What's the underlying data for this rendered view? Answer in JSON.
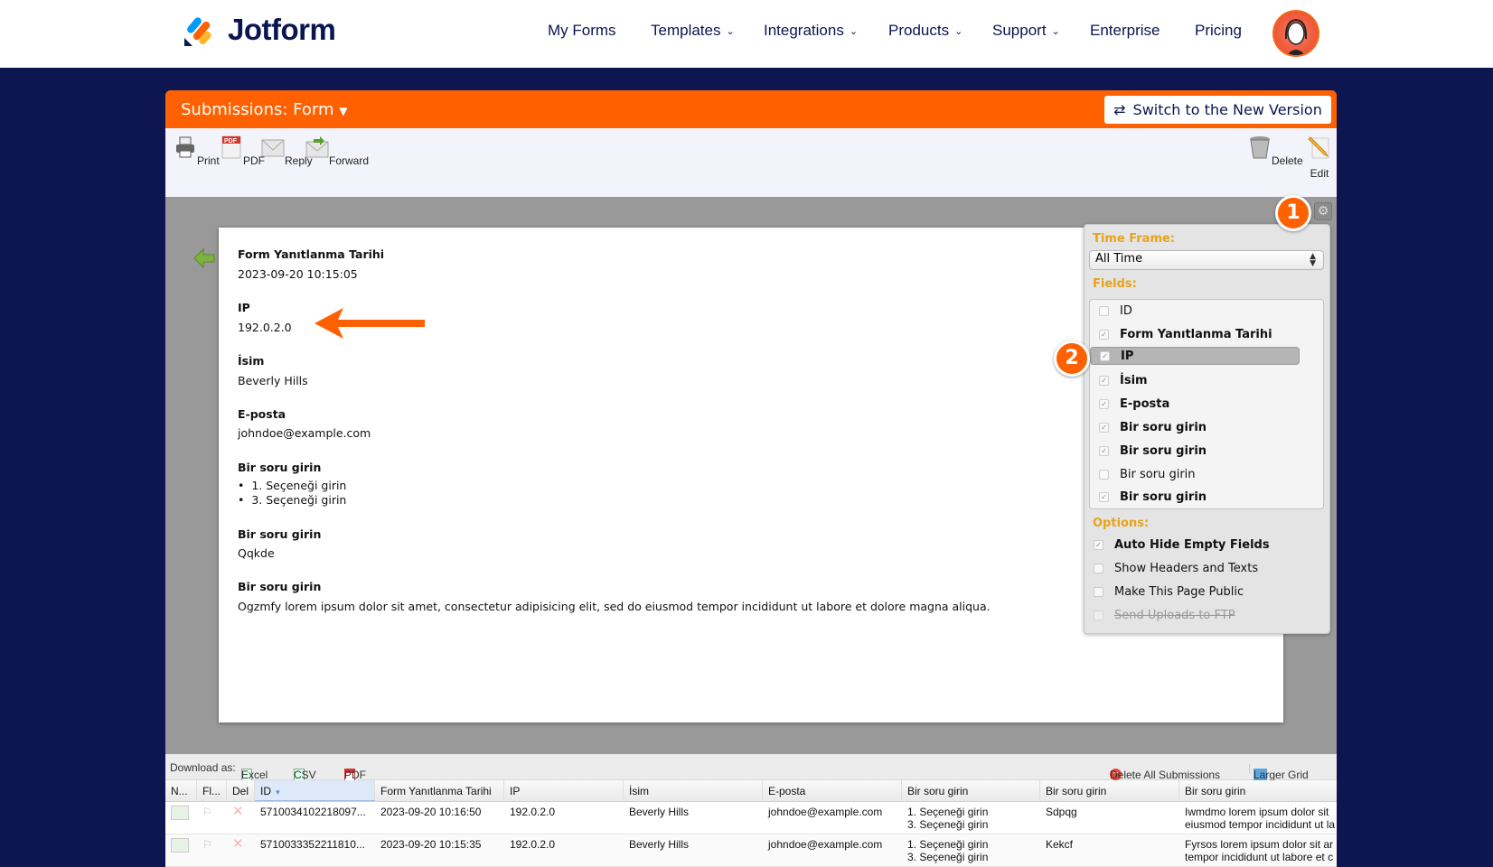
{
  "nav": {
    "brand": "Jotform",
    "items": [
      {
        "label": "My Forms",
        "dropdown": false
      },
      {
        "label": "Templates",
        "dropdown": true
      },
      {
        "label": "Integrations",
        "dropdown": true
      },
      {
        "label": "Products",
        "dropdown": true
      },
      {
        "label": "Support",
        "dropdown": true
      },
      {
        "label": "Enterprise",
        "dropdown": false
      },
      {
        "label": "Pricing",
        "dropdown": false
      }
    ]
  },
  "header": {
    "title": "Submissions: Form",
    "switch_label": "Switch to the New Version"
  },
  "toolbar": {
    "print": "Print",
    "pdf": "PDF",
    "reply": "Reply",
    "forward": "Forward",
    "delete": "Delete",
    "edit": "Edit"
  },
  "submission": [
    {
      "label": "Form Yanıtlanma Tarihi",
      "value": "2023-09-20 10:15:05"
    },
    {
      "label": "IP",
      "value": "192.0.2.0"
    },
    {
      "label": "İsim",
      "value": "Beverly Hills"
    },
    {
      "label": "E-posta",
      "value": "johndoe@example.com"
    },
    {
      "label": "Bir soru girin",
      "list": [
        "1. Seçeneği girin",
        "3. Seçeneği girin"
      ]
    },
    {
      "label": "Bir soru girin",
      "value": "Qqkde"
    },
    {
      "label": "Bir soru girin",
      "value": "Ogzmfy lorem ipsum dolor sit amet, consectetur adipisicing elit, sed do eiusmod tempor incididunt ut labore et dolore magna aliqua."
    }
  ],
  "settings": {
    "time_frame_label": "Time Frame:",
    "time_frame_value": "All Time",
    "fields_label": "Fields:",
    "fields": [
      {
        "label": "ID",
        "checked": false
      },
      {
        "label": "Form Yanıtlanma Tarihi",
        "checked": true
      },
      {
        "label": "IP",
        "checked": true
      },
      {
        "label": "İsim",
        "checked": true
      },
      {
        "label": "E-posta",
        "checked": true
      },
      {
        "label": "Bir soru girin",
        "checked": true
      },
      {
        "label": "Bir soru girin",
        "checked": true
      },
      {
        "label": "Bir soru girin",
        "checked": false
      },
      {
        "label": "Bir soru girin",
        "checked": true
      }
    ],
    "options_label": "Options:",
    "options": [
      {
        "label": "Auto Hide Empty Fields",
        "checked": true
      },
      {
        "label": "Show Headers and Texts",
        "checked": false
      },
      {
        "label": "Make This Page Public",
        "checked": false
      },
      {
        "label": "Send Uploads to FTP",
        "checked": false,
        "disabled": true
      }
    ]
  },
  "badges": {
    "one": "1",
    "two": "2"
  },
  "download": {
    "label": "Download as:",
    "excel": "Excel",
    "csv": "CSV",
    "pdf": "PDF",
    "delete_all": "Delete All Submissions",
    "larger_grid": "Larger Grid"
  },
  "grid": {
    "columns": [
      "N...",
      "Fl...",
      "Del",
      "ID",
      "Form Yanıtlanma Tarihi",
      "IP",
      "İsim",
      "E-posta",
      "Bir soru girin",
      "Bir soru girin",
      "Bir soru girin"
    ],
    "rows": [
      {
        "id": "5710034102218097...",
        "date": "2023-09-20 10:16:50",
        "ip": "192.0.2.0",
        "name": "Beverly Hills",
        "email": "johndoe@example.com",
        "q1a": "1. Seçeneği girin",
        "q1b": "3. Seçeneği girin",
        "q2": "Sdpqg",
        "q3a": "Iwmdmo lorem ipsum dolor sit",
        "q3b": "eiusmod tempor incididunt ut la"
      },
      {
        "id": "5710033352211810...",
        "date": "2023-09-20 10:15:35",
        "ip": "192.0.2.0",
        "name": "Beverly Hills",
        "email": "johndoe@example.com",
        "q1a": "1. Seçeneği girin",
        "q1b": "3. Seçeneği girin",
        "q2": "Kekcf",
        "q3a": "Fyrsos lorem ipsum dolor sit ar",
        "q3b": "tempor incididunt ut labore et c"
      }
    ]
  }
}
